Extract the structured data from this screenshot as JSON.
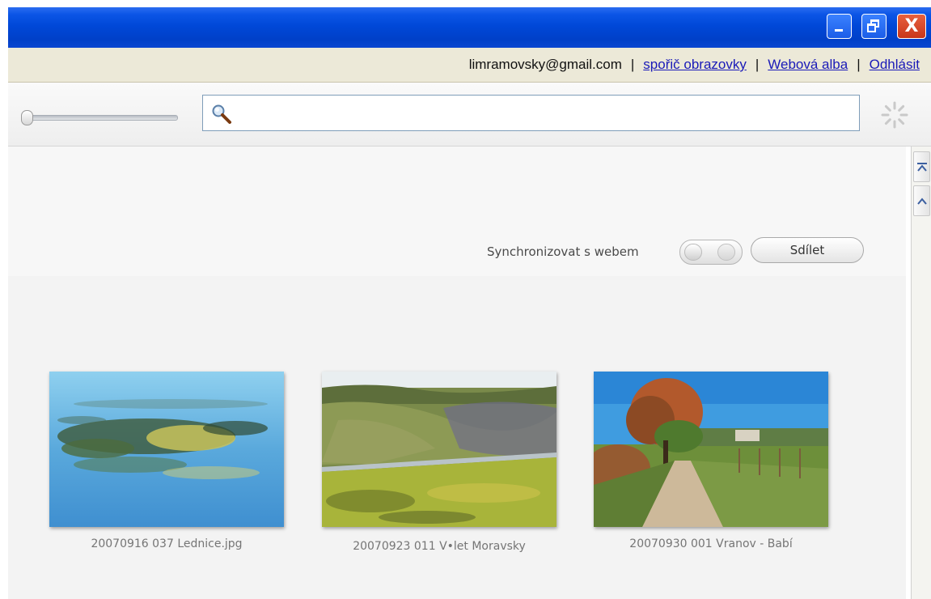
{
  "window": {
    "minimize_label": "_",
    "restore_label": "❐",
    "close_label": "X"
  },
  "account": {
    "email": "limramovsky@gmail.com",
    "screensaver_link": "spořič obrazovky",
    "web_albums_link": "Webová alba",
    "logout_link": "Odhlásit",
    "separator": "|"
  },
  "toolbar": {
    "zoom_slider_value": 0,
    "search_placeholder": "",
    "search_value": ""
  },
  "album": {
    "sync_label": "Synchronizovat s webem",
    "share_label": "Sdílet",
    "photos": [
      {
        "caption": "20070916 037 Lednice.jpg",
        "icon": "water-lilies-photo"
      },
      {
        "caption": "20070923 011 V•let Moravsky",
        "icon": "valley-road-photo"
      },
      {
        "caption": "20070930 001 Vranov - Babí",
        "icon": "country-path-photo"
      }
    ]
  },
  "colors": {
    "titlebar_blue": "#0048d8",
    "link_blue": "#1a1ab8",
    "accountbar_bg": "#ece9d8",
    "close_red": "#c8361a"
  }
}
